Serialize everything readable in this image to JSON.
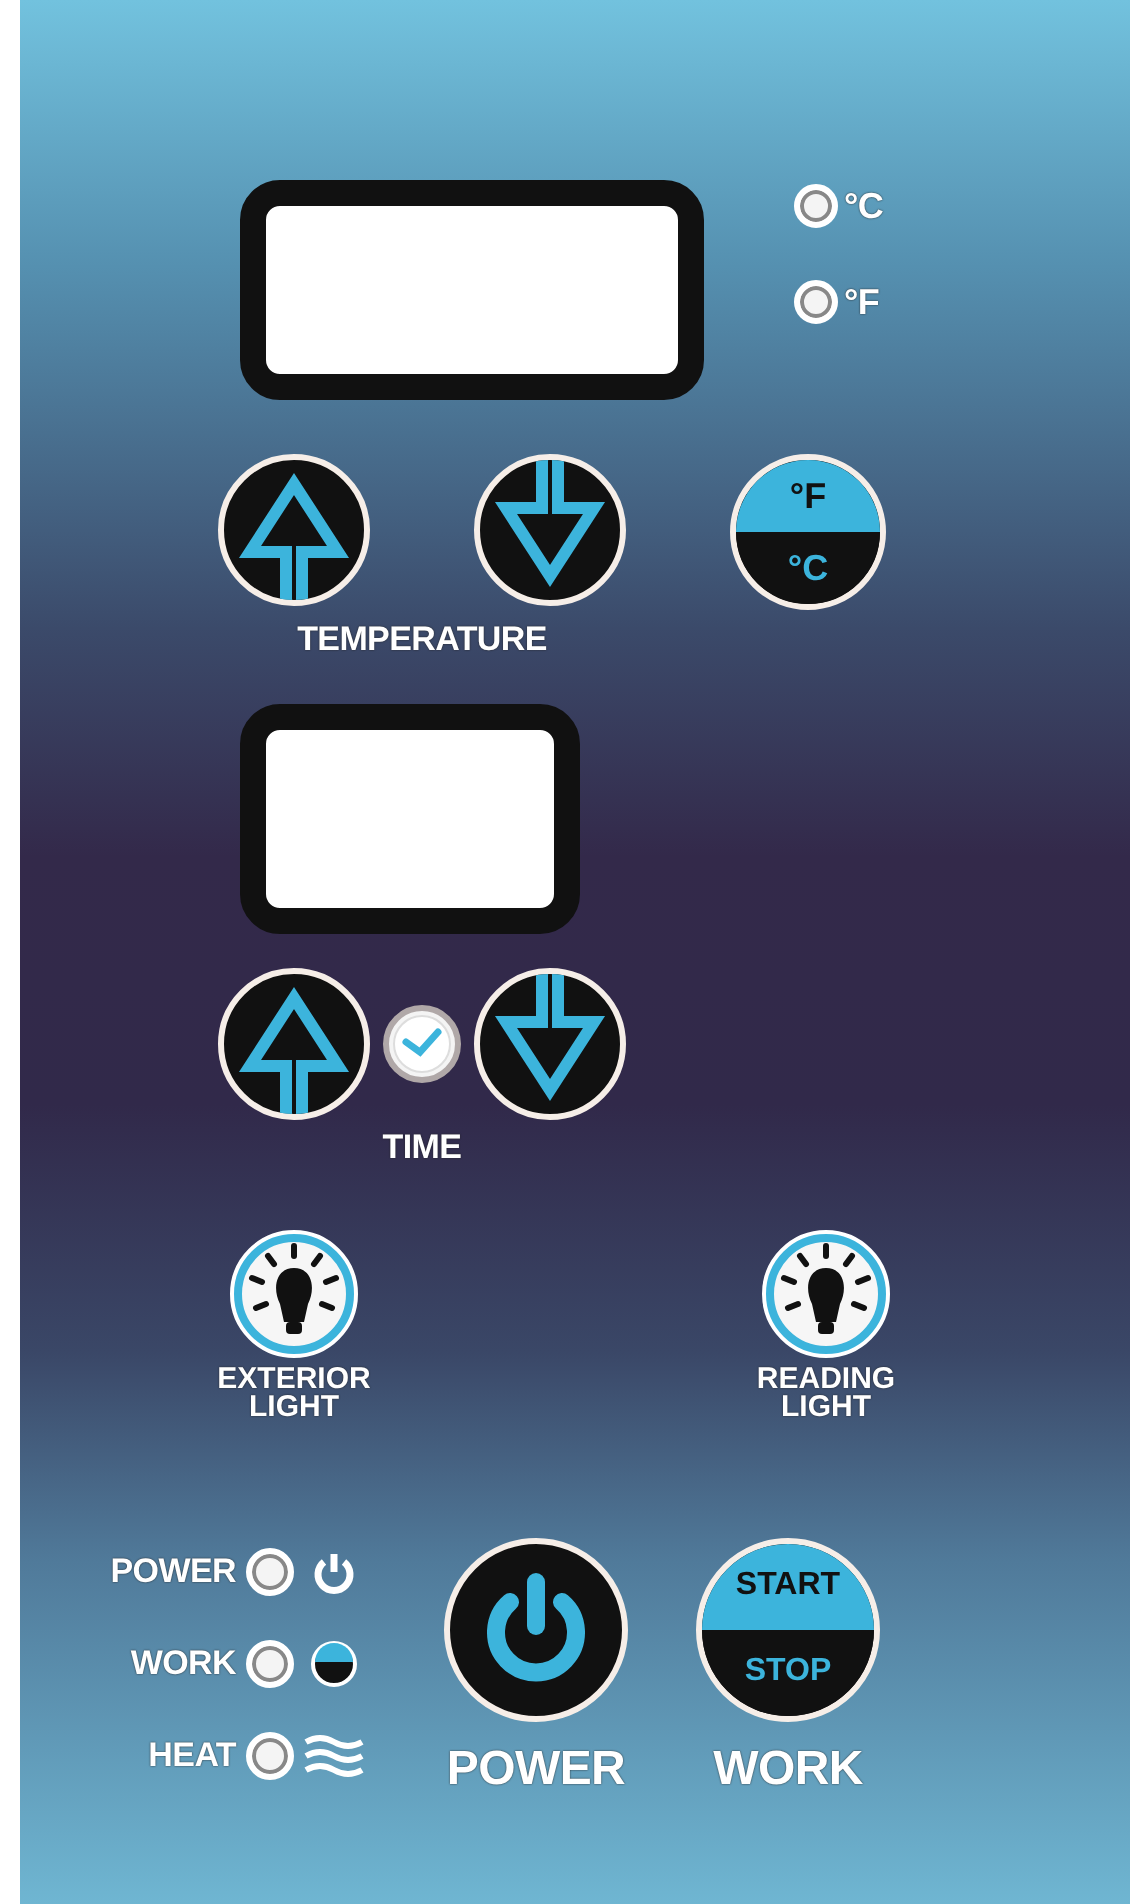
{
  "unit_indicators": [
    {
      "label": "°C"
    },
    {
      "label": "°F"
    }
  ],
  "temperature": {
    "label": "TEMPERATURE",
    "unit_button": {
      "top": "°F",
      "bottom": "°C"
    }
  },
  "time": {
    "label": "TIME"
  },
  "lights": [
    {
      "label": "EXTERIOR LIGHT"
    },
    {
      "label": "READING LIGHT"
    }
  ],
  "status_indicators": [
    {
      "label": "POWER",
      "kind": "power"
    },
    {
      "label": "WORK",
      "kind": "work"
    },
    {
      "label": "HEAT",
      "kind": "heat"
    }
  ],
  "power_button": {
    "label": "POWER"
  },
  "work_button": {
    "top": "START",
    "bottom": "STOP",
    "label": "WORK"
  }
}
